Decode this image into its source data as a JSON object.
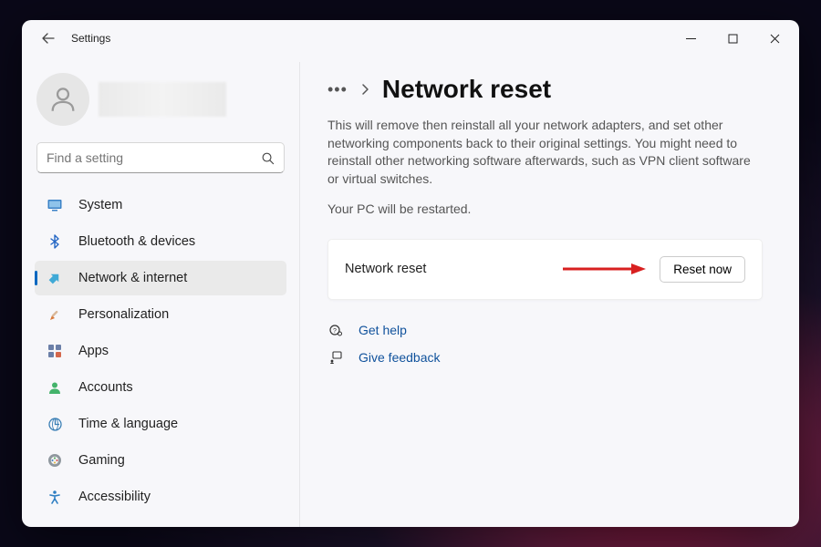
{
  "window": {
    "title": "Settings"
  },
  "search": {
    "placeholder": "Find a setting"
  },
  "sidebar": {
    "items": [
      {
        "label": "System"
      },
      {
        "label": "Bluetooth & devices"
      },
      {
        "label": "Network & internet"
      },
      {
        "label": "Personalization"
      },
      {
        "label": "Apps"
      },
      {
        "label": "Accounts"
      },
      {
        "label": "Time & language"
      },
      {
        "label": "Gaming"
      },
      {
        "label": "Accessibility"
      }
    ],
    "active_index": 2
  },
  "page": {
    "heading": "Network reset",
    "description": "This will remove then reinstall all your network adapters, and set other networking components back to their original settings. You might need to reinstall other networking software afterwards, such as VPN client software or virtual switches.",
    "restart_note": "Your PC will be restarted.",
    "card": {
      "label": "Network reset",
      "button": "Reset now"
    },
    "links": {
      "help": "Get help",
      "feedback": "Give feedback"
    }
  }
}
